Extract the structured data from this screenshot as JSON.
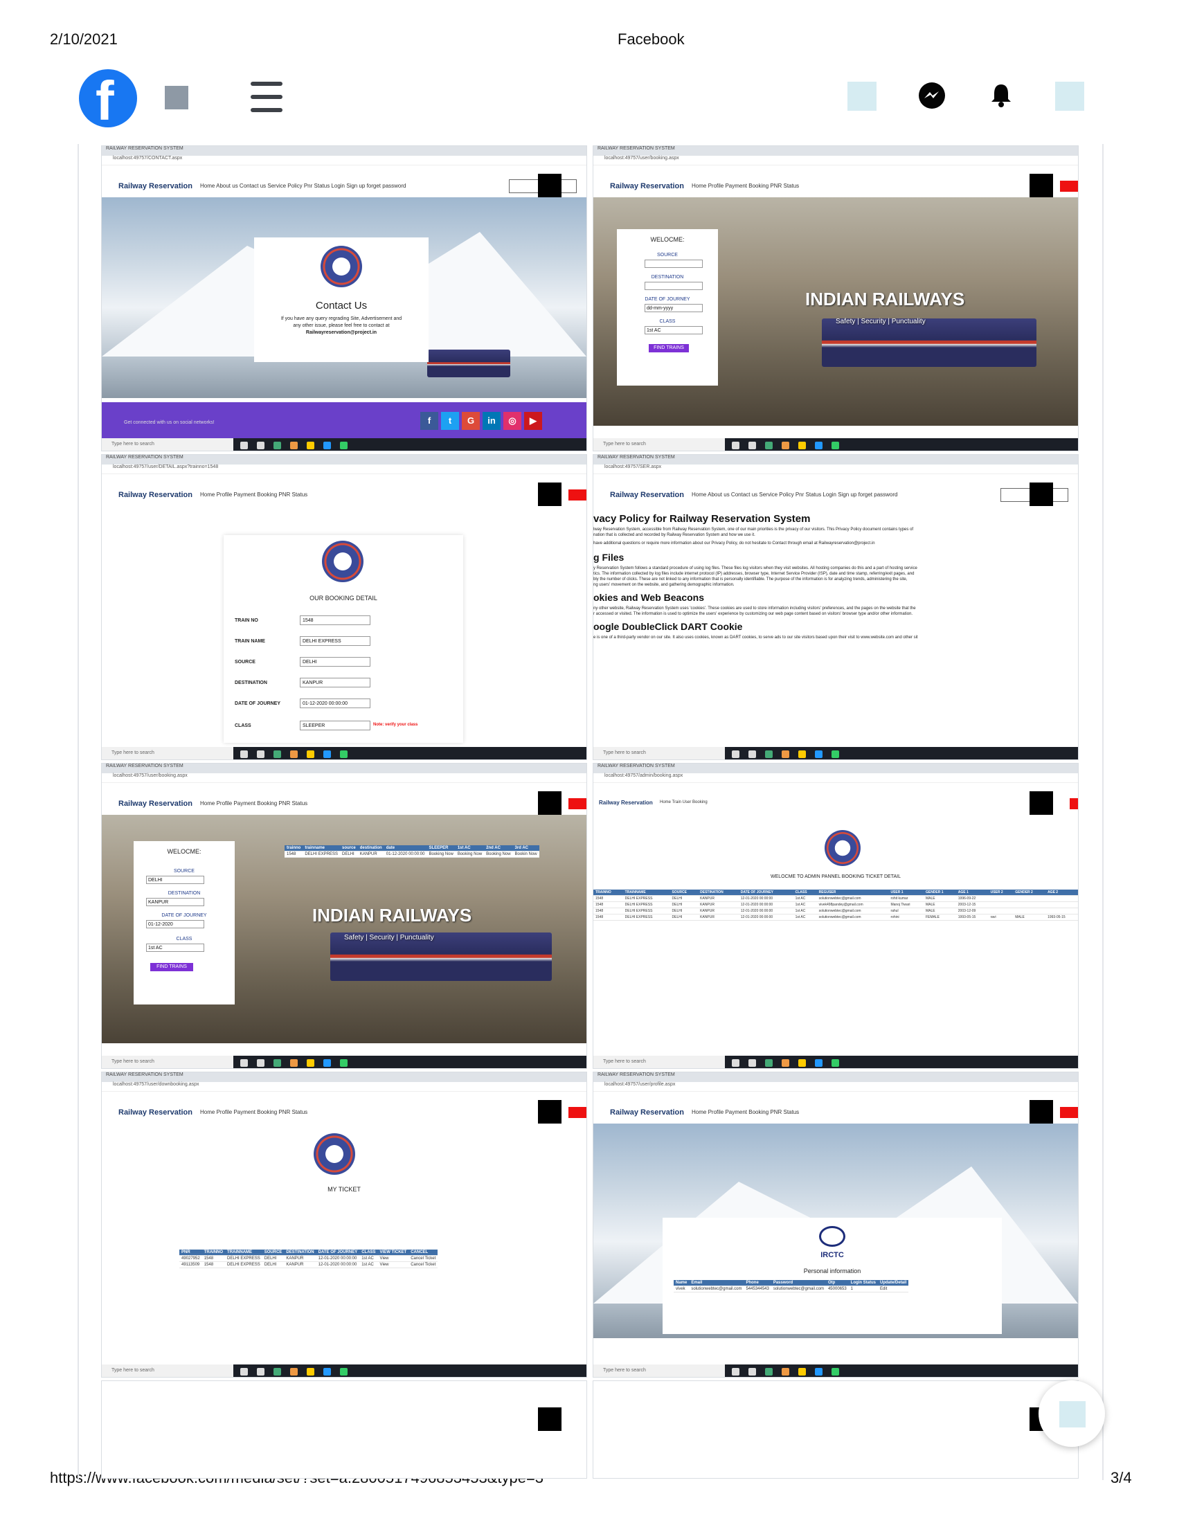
{
  "print_header": {
    "date": "2/10/2021",
    "title": "Facebook"
  },
  "print_footer": {
    "url": "https://www.facebook.com/media/set/?set=a.2800517496853453&type=3",
    "page": "3/4"
  },
  "facebook_bar": {
    "logo_letter": "f",
    "icons": [
      "facebook-logo-icon",
      "menu-icon",
      "messenger-icon",
      "bell-icon"
    ],
    "brand_color": "#1877f2"
  },
  "tiles": {
    "common": {
      "tab": "RAILWAY RESERVATION SYSTEM",
      "brand": "Railway Reservation",
      "taskbar_search": "Type here to search"
    },
    "contact": {
      "url": "localhost:49757/CONTACT.aspx",
      "nav": "Home   About us   Contact us   Service Policy   Pnr Status        Login   Sign up   forget password",
      "heading": "Contact Us",
      "text1": "If you have any query regrading Site, Advertisement and",
      "text2": "any other issue, please feel free to contact at",
      "email": "Railwayreservation@project.in",
      "footer_text": "Get connected with us on social networks!"
    },
    "booking": {
      "url": "localhost:49757/user/booking.aspx",
      "nav": "Home   Profile   Payment   Booking   PNR Status",
      "welcome": "WELOCME:",
      "source_label": "SOURCE",
      "destination_label": "DESTINATION",
      "doj_label": "DATE OF JOURNEY",
      "doj_value": "dd-mm-yyyy",
      "class_label": "CLASS",
      "class_value": "1st AC",
      "find_btn": "FIND TRAINS",
      "hero_title": "INDIAN RAILWAYS",
      "hero_sub": "Safety  |  Security  |  Punctuality"
    },
    "booking_detail": {
      "url": "localhost:49757/user/DETAIL.aspx?trainno=1548",
      "nav": "Home   Profile   Payment   Booking   PNR Status",
      "heading": "OUR BOOKING DETAIL",
      "rows": [
        {
          "label": "TRAIN NO",
          "value": "1548"
        },
        {
          "label": "TRAIN NAME",
          "value": "DELHI EXPRESS"
        },
        {
          "label": "SOURCE",
          "value": "DELHI"
        },
        {
          "label": "DESTINATION",
          "value": "KANPUR"
        },
        {
          "label": "DATE OF JOURNEY",
          "value": "01-12-2020 00:00:00"
        },
        {
          "label": "CLASS",
          "value": "SLEEPER"
        }
      ],
      "note": "Note: verify your class"
    },
    "privacy": {
      "url": "localhost:49757/SER.aspx",
      "nav": "Home   About us   Contact us   Service Policy   Pnr Status        Login   Sign up   forget password",
      "h1": "vacy Policy for Railway Reservation System",
      "p1": "lway Reservation System, accessible from Railway Reservation System, one of our main priorities is the privacy of our visitors. This Privacy Policy document contains types of",
      "p1b": "nation that is collected and recorded by Railway Reservation System and how we use it.",
      "p2": "have additional questions or require more information about our Privacy Policy, do not hesitate to Contact through email at Railwayreservation@project.in",
      "h2": "g Files",
      "p3": "y Reservation System follows a standard procedure of using log files. These files log visitors when they visit websites. All hosting companies do this and a part of hosting service",
      "p3b": "tics. The information collected by log files include internet protocol (IP) addresses, browser type, Internet Service Provider (ISP), date and time stamp, referring/exit pages, and",
      "p3c": "bly the number of clicks. These are not linked to any information that is personally identifiable. The purpose of the information is for analyzing trends, administering the site,",
      "p3d": "ng users' movement on the website, and gathering demographic information.",
      "h3": "okies and Web Beacons",
      "p4": "ny other website, Railway Reservation System uses 'cookies'. These cookies are used to store information including visitors' preferences, and the pages on the website that the",
      "p4b": "r accessed or visited. The information is used to optimize the users' experience by customizing our web page content based on visitors' browser type and/or other information.",
      "h4": "oogle DoubleClick DART Cookie",
      "p5": "e is one of a third-party vendor on our site. It also uses cookies, known as DART cookies, to serve ads to our site visitors based upon their visit to www.website.com and other sit"
    },
    "search": {
      "url": "localhost:49757/user/booking.aspx",
      "nav": "Home   Profile   Payment   Booking   PNR Status",
      "welcome": "WELOCME:",
      "source_label": "SOURCE",
      "source_value": "DELHI",
      "destination_label": "DESTINATION",
      "destination_value": "KANPUR",
      "doj_label": "DATE OF JOURNEY",
      "doj_value": "01-12-2020",
      "class_label": "CLASS",
      "class_value": "1st AC",
      "find_btn": "FIND TRAINS",
      "hero_title": "INDIAN RAILWAYS",
      "hero_sub": "Safety  |  Security  |  Punctuality",
      "result_headers": [
        "trainno",
        "trainname",
        "source",
        "destination",
        "date",
        "SLEEPER",
        "1st AC",
        "2nd AC",
        "3rd AC"
      ],
      "result_row": [
        "1548",
        "DELHI EXPRESS",
        "DELHI",
        "KANPUR",
        "01-12-2020 00:00:00",
        "Booking Now",
        "Booking Now",
        "Booking Now",
        "Bookin Now"
      ]
    },
    "admin": {
      "url": "localhost:49757/admin/booking.aspx",
      "nav": "Home   Train   User   Booking",
      "heading": "WELOCME TO ADMIN PANNEL BOOKING TICKET DETAIL",
      "headers": [
        "TRAINNO",
        "TRAINNAME",
        "SOURCE",
        "DESTINATION",
        "DATE OF JOURNEY",
        "CLASS",
        "REGUSER",
        "USER 1",
        "GENDER 1",
        "AGE 1",
        "USER 2",
        "GENDER 2",
        "AGE 2"
      ],
      "rows": [
        [
          "1548",
          "DELHI EXPRESS",
          "DELHI",
          "KANPUR",
          "12-01-2020 00:00:00",
          "1st AC",
          "solutionwebtec@gmail.com",
          "rohit kumar",
          "MALE",
          "1996-09-22",
          "",
          "",
          ""
        ],
        [
          "1548",
          "DELHI EXPRESS",
          "DELHI",
          "KANPUR",
          "12-01-2020 00:00:00",
          "1st AC",
          "vivek498pandey@gmail.com",
          "Manoj Tiwari",
          "MALE",
          "2003-12-15",
          "",
          "",
          ""
        ],
        [
          "1548",
          "DELHI EXPRESS",
          "DELHI",
          "KANPUR",
          "12-01-2020 00:00:00",
          "1st AC",
          "solutionwebtec@gmail.com",
          "rahul",
          "MALE",
          "2003-12-09",
          "",
          "",
          ""
        ],
        [
          "1548",
          "DELHI EXPRESS",
          "DELHI",
          "KANPUR",
          "12-01-2020 00:00:00",
          "1st AC",
          "solutionwebtec@gmail.com",
          "rohini",
          "FEMALE",
          "1993-05-15",
          "ravi",
          "MALE",
          "1993-05-15"
        ]
      ]
    },
    "myticket": {
      "url": "localhost:49757/user/downbooking.aspx",
      "nav": "Home   Profile   Payment   Booking   PNR Status",
      "heading": "MY TICKET",
      "headers": [
        "PNR",
        "TRAINNO",
        "TRAINNAME",
        "SOURCE",
        "DESTINATION",
        "DATE OF JOURNEY",
        "CLASS",
        "VIEW TICKET",
        "CANCEL"
      ],
      "rows": [
        [
          "49027952",
          "1548",
          "DELHI EXPRESS",
          "DELHI",
          "KANPUR",
          "12-01-2020 00:00:00",
          "1st AC",
          "View",
          "Cancel Ticket"
        ],
        [
          "49113509",
          "1548",
          "DELHI EXPRESS",
          "DELHI",
          "KANPUR",
          "12-01-2020 00:00:00",
          "1st AC",
          "View",
          "Cancel Ticket"
        ]
      ]
    },
    "profile": {
      "url": "localhost:49757/user/profile.aspx",
      "nav": "Home   Profile   Payment   Booking   PNR Status",
      "logo_text": "IRCTC",
      "heading": "Personal information",
      "headers": [
        "Name",
        "Email",
        "Phone",
        "Password",
        "Otp",
        "Login Status",
        "Update/Detail"
      ],
      "row": [
        "vivek",
        "solutionwebtec@gmail.com",
        "5445344543",
        "solutionwebtec@gmail.com",
        "45000653",
        "1",
        "Edit"
      ]
    }
  }
}
